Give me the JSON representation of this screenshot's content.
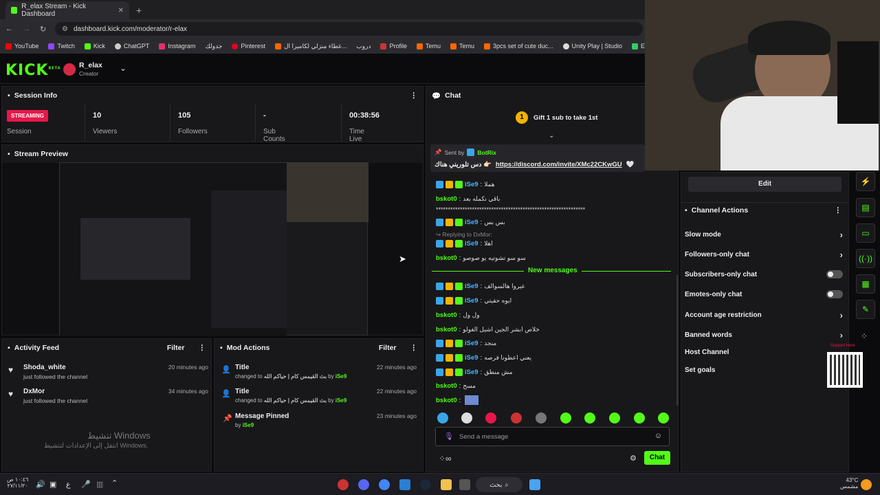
{
  "browser": {
    "tab_title": "R_elax Stream - Kick Dashboard",
    "new_tab": "+",
    "url": "dashboard.kick.com/moderator/r-elax",
    "bookmarks": [
      "YouTube",
      "Twitch",
      "Kick",
      "ChatGPT",
      "Instagram",
      "جدولك",
      "Pinterest",
      "غطاء منزلي لكاميرا ال...",
      "دروب",
      "Profile",
      "Temu",
      "Temu",
      "3pcs set of cute duc...",
      "Unity Play | Studio",
      "EveryCircuit"
    ]
  },
  "header": {
    "logo": "KICK",
    "logo_sup": "BETA",
    "channel": "R_elax",
    "role": "Creator"
  },
  "session": {
    "title": "Session Info",
    "status": "STREAMING",
    "status_label": "Session",
    "viewers": "10",
    "viewers_label": "Viewers",
    "followers": "105",
    "followers_label": "Followers",
    "subs": "-",
    "subs_label": "Sub Counts",
    "time": "00:38:56",
    "time_label": "Time Live"
  },
  "preview": {
    "title": "Stream Preview"
  },
  "activity": {
    "title": "Activity Feed",
    "filter": "Filter",
    "items": [
      {
        "name": "Shoda_white",
        "sub": "just followed the channel",
        "time": "20 minutes ago"
      },
      {
        "name": "DxMor",
        "sub": "just followed the channel",
        "time": "34 minutes ago"
      }
    ],
    "watermark1": "تنشيط Windows",
    "watermark2": "انتقل إلى الإعدادات لتنشيط Windows."
  },
  "mod": {
    "title": "Mod Actions",
    "filter": "Filter",
    "items": [
      {
        "name": "Title",
        "sub_prefix": "changed to",
        "sub_value": "بث القيمس كام | حياكم الله",
        "by": "by",
        "user": "iSe9",
        "time": "22 minutes ago"
      },
      {
        "name": "Title",
        "sub_prefix": "changed to",
        "sub_value": "بث القيمس كام | حياكم الله",
        "by": "by",
        "user": "iSe9",
        "time": "22 minutes ago"
      },
      {
        "name": "Message Pinned",
        "sub_prefix": "by",
        "sub_value": "",
        "by": "",
        "user": "iSe9",
        "time": "23 minutes ago"
      }
    ]
  },
  "chat": {
    "title": "Chat",
    "gift": "Gift 1 sub to take 1st",
    "gift_num": "1",
    "pinned_sent_by": "Sent by",
    "pinned_user": "BotRix",
    "pinned_text": "دس تلوريني هناك 👉🏻",
    "pinned_link": "https://discord.com/invite/XMc22CKwGU",
    "messages": [
      {
        "user": "iSe9",
        "color": "#4fb3ff",
        "text": "هملا",
        "icons": [
          "b",
          "y",
          "g"
        ]
      },
      {
        "user": "bskot0",
        "color": "#53fc18",
        "text": "باقي نكمله بعد",
        "icons": []
      },
      {
        "user": "",
        "color": "#ddd",
        "text": "**************************************************************",
        "icons": []
      },
      {
        "user": "iSe9",
        "color": "#4fb3ff",
        "text": "بس بس",
        "icons": [
          "b",
          "y",
          "g"
        ]
      },
      {
        "user": "iSe9",
        "color": "#4fb3ff",
        "text": "اهلا",
        "icons": [
          "b",
          "y",
          "g"
        ]
      },
      {
        "user": "bskot0",
        "color": "#53fc18",
        "text": "سو سو تشوتيه يو صوصو",
        "icons": []
      },
      {
        "user": "iSe9",
        "color": "#4fb3ff",
        "text": "عيروا هالسوالف",
        "icons": [
          "b",
          "y",
          "g"
        ]
      },
      {
        "user": "iSe9",
        "color": "#4fb3ff",
        "text": "ايوه حقيتي",
        "icons": [
          "b",
          "y",
          "g"
        ]
      },
      {
        "user": "bskot0",
        "color": "#53fc18",
        "text": "ول ول",
        "icons": []
      },
      {
        "user": "bskot0",
        "color": "#53fc18",
        "text": "خلاص ابشر الجين اشيل الغولو",
        "icons": []
      },
      {
        "user": "iSe9",
        "color": "#4fb3ff",
        "text": "منجد",
        "icons": [
          "b",
          "y",
          "g"
        ]
      },
      {
        "user": "iSe9",
        "color": "#4fb3ff",
        "text": "يعني اعطونا فرصه",
        "icons": [
          "b",
          "y",
          "g"
        ]
      },
      {
        "user": "iSe9",
        "color": "#4fb3ff",
        "text": "مش منطق",
        "icons": [
          "b",
          "y",
          "g"
        ]
      },
      {
        "user": "bskot0",
        "color": "#53fc18",
        "text": "مسح",
        "icons": []
      },
      {
        "user": "bskot0",
        "color": "#53fc18",
        "text": "",
        "icons": []
      }
    ],
    "reply_label": "Replying to DxMor:",
    "new_messages": "New messages",
    "input_placeholder": "Send a message",
    "send": "Chat"
  },
  "actions": {
    "edit": "Edit",
    "title": "Channel Actions",
    "items": [
      {
        "label": "Slow mode",
        "kind": "arrow"
      },
      {
        "label": "Followers-only chat",
        "kind": "arrow"
      },
      {
        "label": "Subscribers-only chat",
        "kind": "toggle"
      },
      {
        "label": "Emotes-only chat",
        "kind": "toggle"
      },
      {
        "label": "Account age restriction",
        "kind": "arrow"
      },
      {
        "label": "Banned words",
        "kind": "arrow"
      },
      {
        "label": "Host Channel",
        "kind": "none"
      },
      {
        "label": "Set goals",
        "kind": "none"
      }
    ],
    "support": "Support Here"
  },
  "taskbar": {
    "time": "١٠:٤٦ ص",
    "date": "٢٧/١١/٢٠",
    "search": "بحث",
    "temp": "43°C",
    "weather": "مشمس",
    "lang": "ع"
  },
  "colors": {
    "accent": "#53fc18",
    "streaming": "#e8174a",
    "panel": "#18181b"
  }
}
